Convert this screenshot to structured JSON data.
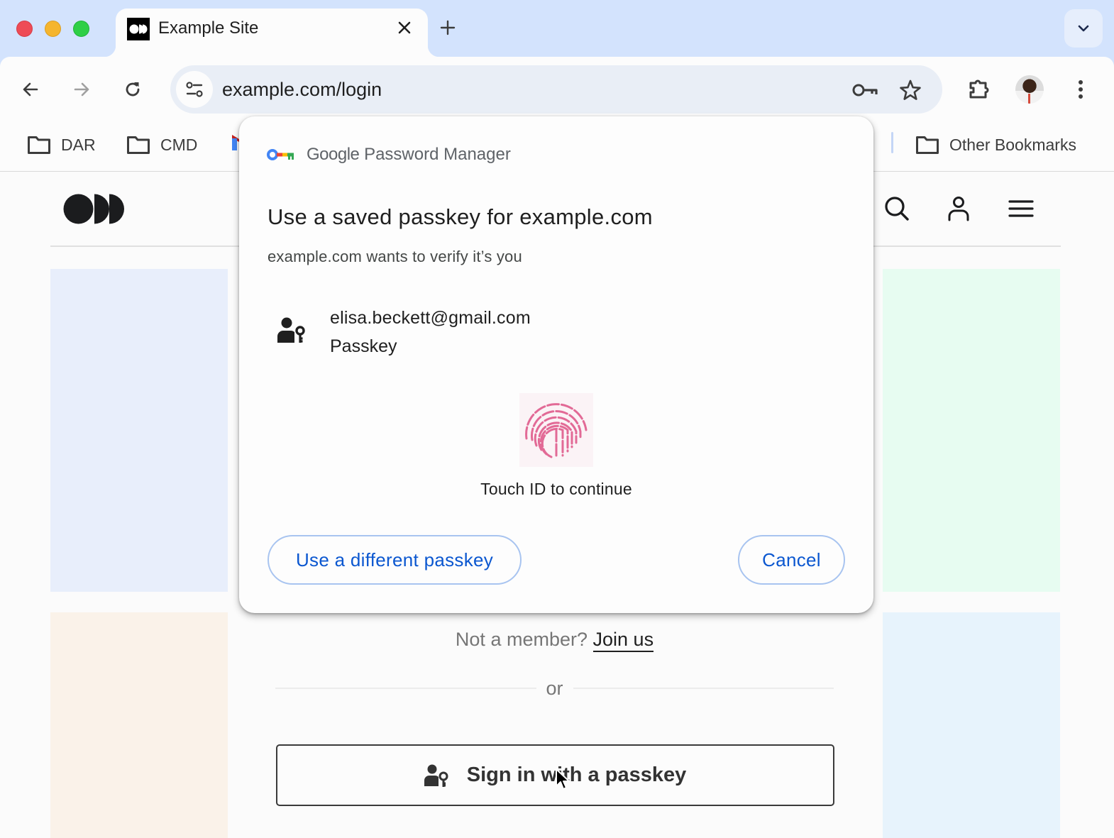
{
  "browser": {
    "tab": {
      "title": "Example Site",
      "close_icon": "close-icon"
    },
    "new_tab_icon": "plus-icon",
    "tab_search_icon": "chevron-down-icon",
    "omnibox": {
      "url": "example.com/login"
    },
    "icons": [
      "back-arrow-icon",
      "forward-arrow-icon",
      "reload-icon",
      "site-info-icon",
      "key-icon",
      "star-icon",
      "extensions-icon",
      "avatar",
      "more-vert-icon"
    ]
  },
  "bookmarks": {
    "items": [
      {
        "label": "DAR",
        "icon": "folder-icon"
      },
      {
        "label": "CMD",
        "icon": "folder-icon"
      },
      {
        "label": "",
        "icon": "gmail-icon"
      }
    ],
    "other": {
      "label": "Other Bookmarks",
      "icon": "folder-icon"
    }
  },
  "page": {
    "header_icons": [
      "search-icon",
      "person-icon",
      "menu-icon"
    ],
    "tile_colors": [
      "#e8eefb",
      "#faf2e9",
      "#e7fcf1",
      "#e7f3fc"
    ],
    "member_prompt": "Not a member?",
    "join_link": "Join us",
    "divider_text": "or",
    "passkey_button": "Sign in with a passkey"
  },
  "dialog": {
    "brand_google": "Google",
    "brand_product": "Password Manager",
    "title": "Use a saved passkey for example.com",
    "subtitle": "example.com wants to verify it’s you",
    "account": {
      "email": "elisa.beckett@gmail.com",
      "type": "Passkey"
    },
    "touch_prompt": "Touch ID to continue",
    "buttons": {
      "different": "Use a different passkey",
      "cancel": "Cancel"
    },
    "accent_color": "#0b57d0",
    "fingerprint_color": "#e26a96"
  }
}
